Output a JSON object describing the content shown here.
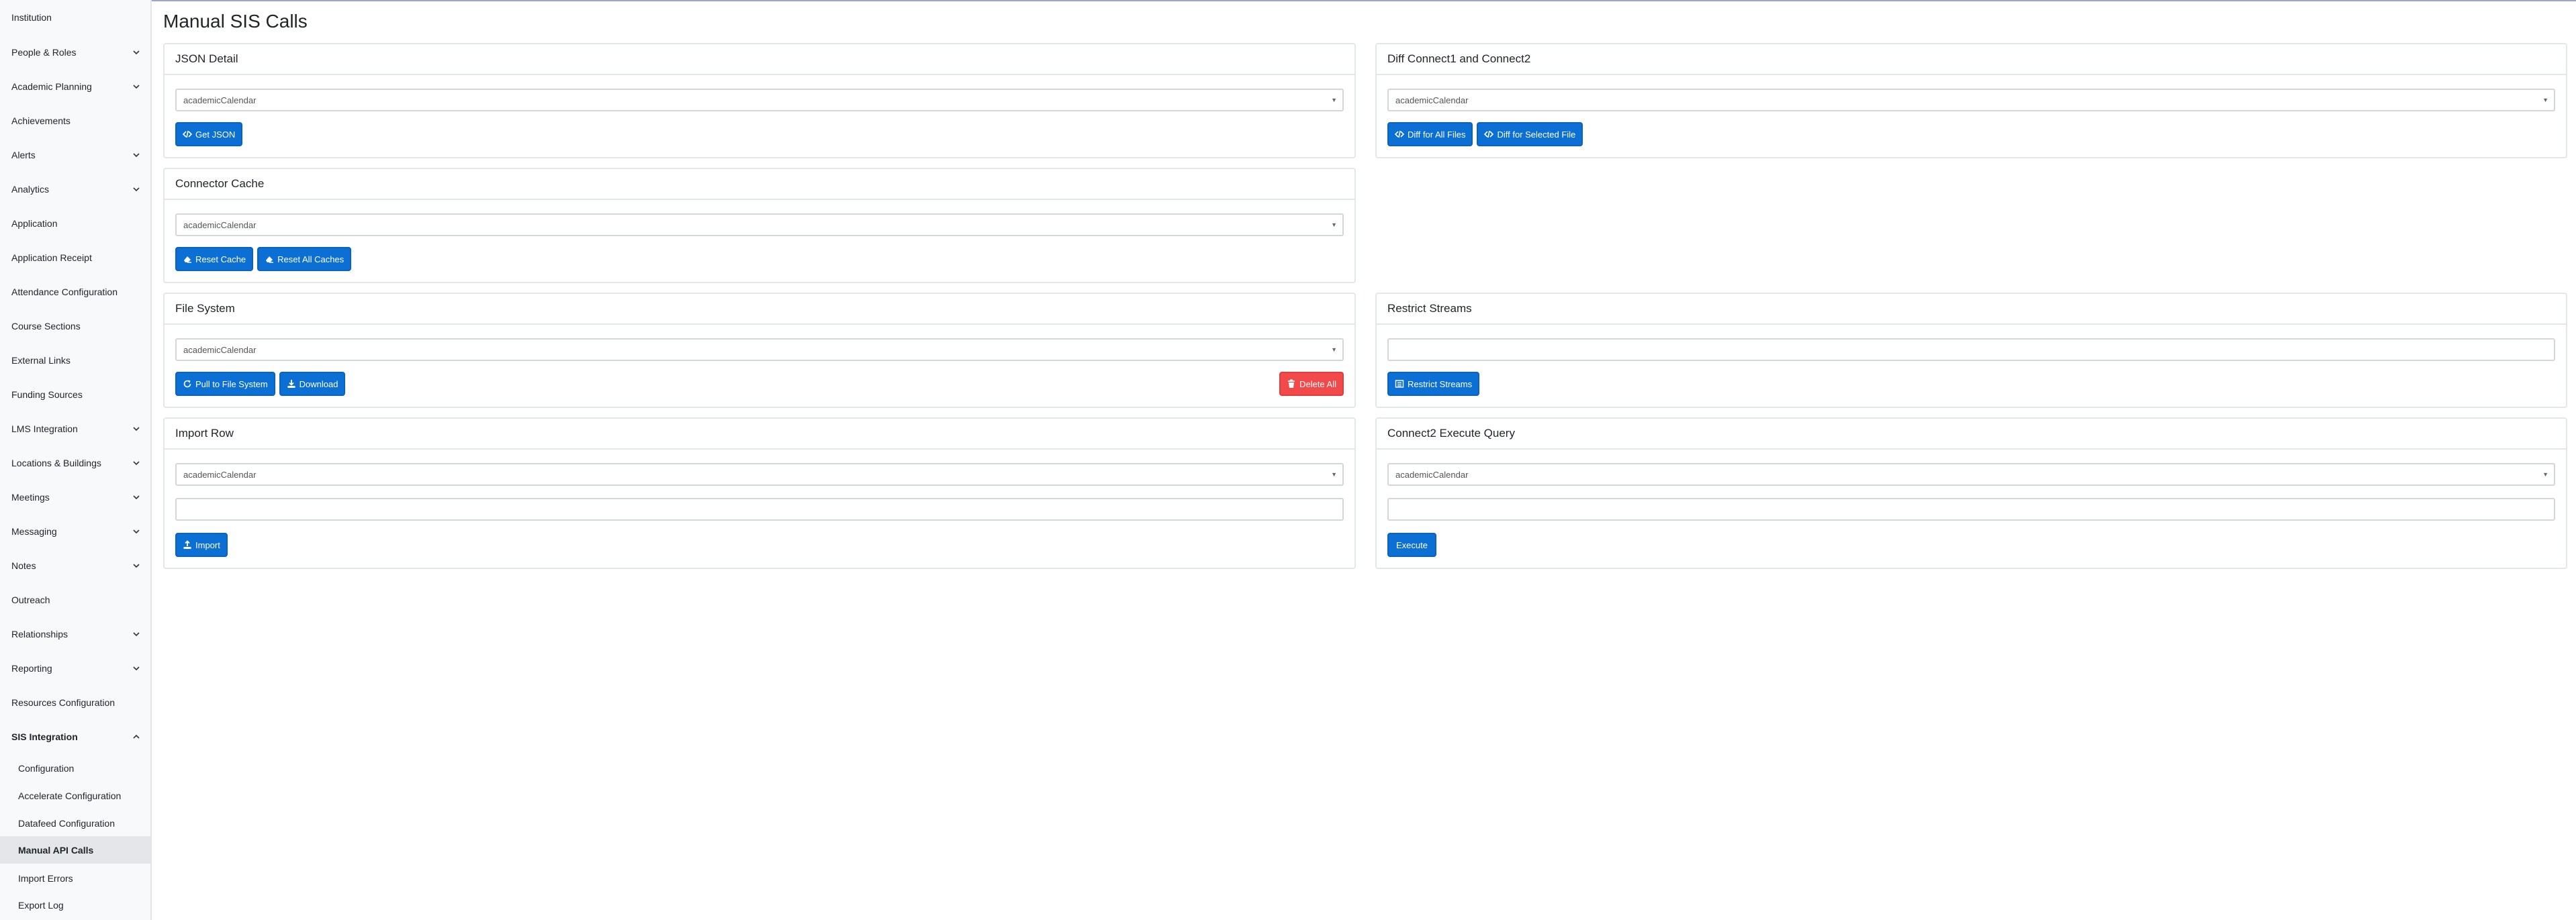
{
  "page": {
    "title": "Manual SIS Calls"
  },
  "sidebar": {
    "items": [
      {
        "label": "Institution"
      },
      {
        "label": "People & Roles"
      },
      {
        "label": "Academic Planning"
      },
      {
        "label": "Achievements"
      },
      {
        "label": "Alerts"
      },
      {
        "label": "Analytics"
      },
      {
        "label": "Application"
      },
      {
        "label": "Application Receipt"
      },
      {
        "label": "Attendance Configuration"
      },
      {
        "label": "Course Sections"
      },
      {
        "label": "External Links"
      },
      {
        "label": "Funding Sources"
      },
      {
        "label": "LMS Integration"
      },
      {
        "label": "Locations & Buildings"
      },
      {
        "label": "Meetings"
      },
      {
        "label": "Messaging"
      },
      {
        "label": "Notes"
      },
      {
        "label": "Outreach"
      },
      {
        "label": "Relationships"
      },
      {
        "label": "Reporting"
      },
      {
        "label": "Resources Configuration"
      },
      {
        "label": "SIS Integration"
      }
    ],
    "subitems": [
      {
        "label": "Configuration"
      },
      {
        "label": "Accelerate Configuration"
      },
      {
        "label": "Datafeed Configuration"
      },
      {
        "label": "Manual API Calls"
      },
      {
        "label": "Import Errors"
      },
      {
        "label": "Export Log"
      }
    ]
  },
  "cards": {
    "json_detail": {
      "title": "JSON Detail",
      "select_value": "academicCalendar",
      "buttons": {
        "get_json": "Get JSON"
      }
    },
    "diff": {
      "title": "Diff Connect1 and Connect2",
      "select_value": "academicCalendar",
      "buttons": {
        "all_files": "Diff for All Files",
        "selected_file": "Diff for Selected File"
      }
    },
    "connector_cache": {
      "title": "Connector Cache",
      "select_value": "academicCalendar",
      "buttons": {
        "reset": "Reset Cache",
        "reset_all": "Reset All Caches"
      }
    },
    "file_system": {
      "title": "File System",
      "select_value": "academicCalendar",
      "buttons": {
        "pull": "Pull to File System",
        "download": "Download",
        "delete_all": "Delete All"
      }
    },
    "restrict_streams": {
      "title": "Restrict Streams",
      "input_value": "",
      "buttons": {
        "restrict": "Restrict Streams"
      }
    },
    "import_row": {
      "title": "Import Row",
      "select_value": "academicCalendar",
      "input_value": "",
      "buttons": {
        "import": "Import"
      }
    },
    "execute_query": {
      "title": "Connect2 Execute Query",
      "select_value": "academicCalendar",
      "input_value": "",
      "buttons": {
        "execute": "Execute"
      }
    }
  },
  "colors": {
    "primary": "#0b6fd4",
    "danger": "#f24a4a",
    "sidebar_bg": "#f8f9fa",
    "active_item_bg": "#e4e6e9"
  },
  "icons": {
    "chevron_down": "chevron-down-icon",
    "chevron_up": "chevron-up-icon",
    "code": "code-icon",
    "eraser": "eraser-icon",
    "refresh": "refresh-icon",
    "download": "download-icon",
    "trash": "trash-icon",
    "list": "list-icon",
    "upload": "upload-icon"
  }
}
